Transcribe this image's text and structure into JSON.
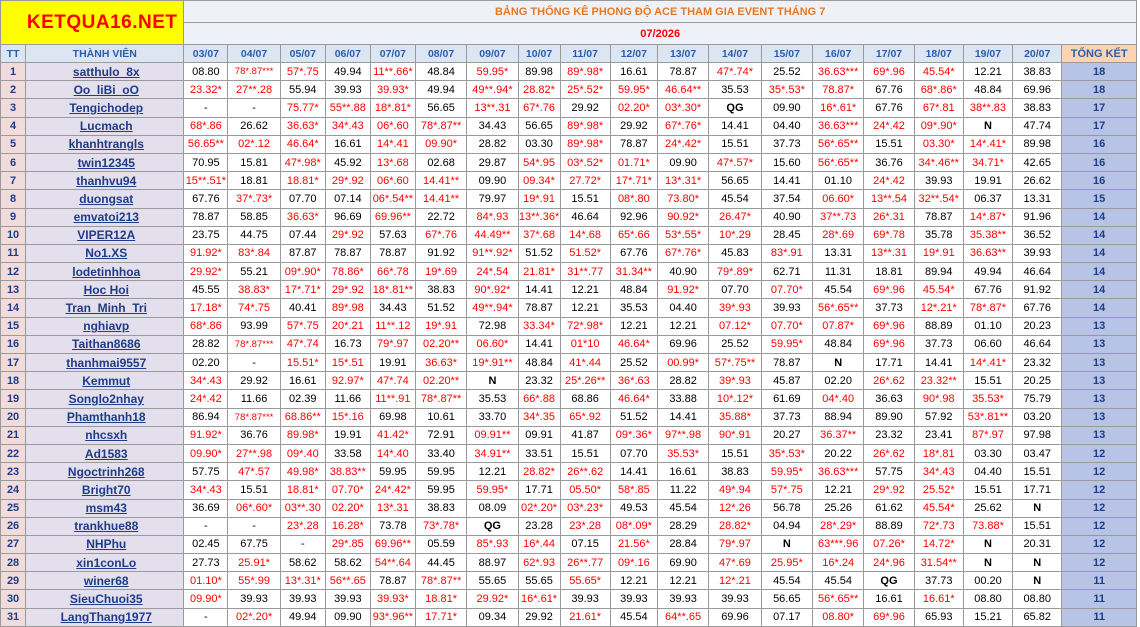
{
  "logo": "KETQUA16.NET",
  "title": "BẢNG THỐNG KÊ PHONG ĐỘ ACE THAM GIA EVENT THÁNG 7",
  "month": "07/2026",
  "columns": {
    "tt": "TT",
    "member": "THÀNH VIÊN",
    "dates": [
      "03/07",
      "04/07",
      "05/07",
      "06/07",
      "07/07",
      "08/07",
      "09/07",
      "10/07",
      "11/07",
      "12/07",
      "13/07",
      "14/07",
      "15/07",
      "16/07",
      "17/07",
      "18/07",
      "19/07",
      "20/07"
    ],
    "total": "TỔNG KẾT"
  },
  "colors": {
    "red_value": "#ff0000",
    "black_value": "#000000",
    "logo_bg": "#ffff00",
    "header_bg": "#dce6f2",
    "total_bg": "#b8c4e6",
    "name_bg": "#e4dfec"
  },
  "rows": [
    {
      "tt": "1",
      "name": "satthulo_8x",
      "total": "18",
      "values": [
        "08.80",
        "78*.87***",
        "57*.75",
        "49.94",
        "11**.66*",
        "48.84",
        "59.95*",
        "89.98",
        "89*.98*",
        "16.61",
        "78.87",
        "47*.74*",
        "25.52",
        "36.63***",
        "69*.96",
        "45.54*",
        "12.21",
        "38.83"
      ]
    },
    {
      "tt": "2",
      "name": "Oo_liBi_oO",
      "total": "18",
      "values": [
        "23.32*",
        "27**.28",
        "55.94",
        "39.93",
        "39.93*",
        "49.94",
        "49**.94*",
        "28.82*",
        "25*.52*",
        "59.95*",
        "46.64**",
        "35.53",
        "35*.53*",
        "78.87*",
        "67.76",
        "68*.86*",
        "48.84",
        "69.96"
      ]
    },
    {
      "tt": "3",
      "name": "Tengichodep",
      "total": "17",
      "values": [
        "-",
        "-",
        "75.77*",
        "55**.88",
        "18*.81*",
        "56.65",
        "13**.31",
        "67*.76",
        "29.92",
        "02.20*",
        "03*.30*",
        "QG",
        "09.90",
        "16*.61*",
        "67.76",
        "67*.81",
        "38**.83",
        "38.83"
      ]
    },
    {
      "tt": "4",
      "name": "Lucmach",
      "total": "17",
      "values": [
        "68*.86",
        "26.62",
        "36.63*",
        "34*.43",
        "06*.60",
        "78*.87**",
        "34.43",
        "56.65",
        "89*.98*",
        "29.92",
        "67*.76*",
        "14.41",
        "04.40",
        "36.63***",
        "24*.42",
        "09*.90*",
        "N",
        "47.74"
      ]
    },
    {
      "tt": "5",
      "name": "khanhtrangls",
      "total": "16",
      "values": [
        "56.65**",
        "02*.12",
        "46.64*",
        "16.61",
        "14*.41",
        "09.90*",
        "28.82",
        "03.30",
        "89*.98*",
        "78.87",
        "24*.42*",
        "15.51",
        "37.73",
        "56*.65**",
        "15.51",
        "03.30*",
        "14*.41*",
        "89.98"
      ]
    },
    {
      "tt": "6",
      "name": "twin12345",
      "total": "16",
      "values": [
        "70.95",
        "15.81",
        "47*.98*",
        "45.92",
        "13*.68",
        "02.68",
        "29.87",
        "54*.95",
        "03*.52*",
        "01.71*",
        "09.90",
        "47*.57*",
        "15.60",
        "56*.65**",
        "36.76",
        "34*.46**",
        "34.71*",
        "42.65"
      ]
    },
    {
      "tt": "7",
      "name": "thanhvu94",
      "total": "16",
      "values": [
        "15**.51*",
        "18.81",
        "18.81*",
        "29*.92",
        "06*.60",
        "14.41**",
        "09.90",
        "09.34*",
        "27.72*",
        "17*.71*",
        "13*.31*",
        "56.65",
        "14.41",
        "01.10",
        "24*.42",
        "39.93",
        "19.91",
        "26.62"
      ]
    },
    {
      "tt": "8",
      "name": "duongsat",
      "total": "15",
      "values": [
        "67.76",
        "37*.73*",
        "07.70",
        "07.14",
        "06*.54**",
        "14.41**",
        "79.97",
        "19*.91",
        "15.51",
        "08*.80",
        "73.80*",
        "45.54",
        "37.54",
        "06.60*",
        "13**.54",
        "32**.54*",
        "06.37",
        "13.31"
      ]
    },
    {
      "tt": "9",
      "name": "emvatoi213",
      "total": "14",
      "values": [
        "78.87",
        "58.85",
        "36.63*",
        "96.69",
        "69.96**",
        "22.72",
        "84*.93",
        "13**.36*",
        "46.64",
        "92.96",
        "90.92*",
        "26.47*",
        "40.90",
        "37**.73",
        "26*.31",
        "78.87",
        "14*.87*",
        "91.96"
      ]
    },
    {
      "tt": "10",
      "name": "VIPER12A",
      "total": "14",
      "values": [
        "23.75",
        "44.75",
        "07.44",
        "29*.92",
        "57.63",
        "67*.76",
        "44.49**",
        "37*.68",
        "14*.68",
        "65*.66",
        "53*.55*",
        "10*.29",
        "28.45",
        "28*.69",
        "69*.78",
        "35.78",
        "35.38**",
        "36.52"
      ]
    },
    {
      "tt": "11",
      "name": "No1.XS",
      "total": "14",
      "values": [
        "91.92*",
        "83*.84",
        "87.87",
        "78.87",
        "78.87",
        "91.92",
        "91**.92*",
        "51.52",
        "51.52*",
        "67.76",
        "67*.76*",
        "45.83",
        "83*.91",
        "13.31",
        "13**.31",
        "19*.91",
        "36.63**",
        "39.93"
      ]
    },
    {
      "tt": "12",
      "name": "lodetinhhoa",
      "total": "14",
      "values": [
        "29.92*",
        "55.21",
        "09*.90*",
        "78.86*",
        "66*.78",
        "19*.69",
        "24*.54",
        "21.81*",
        "31**.77",
        "31.34**",
        "40.90",
        "79*.89*",
        "62.71",
        "11.31",
        "18.81",
        "89.94",
        "49.94",
        "46.64"
      ]
    },
    {
      "tt": "13",
      "name": "Hoc Hoi",
      "total": "14",
      "values": [
        "45.55",
        "38.83*",
        "17*.71*",
        "29*.92",
        "18*.81**",
        "38.83",
        "90*.92*",
        "14.41",
        "12.21",
        "48.84",
        "91.92*",
        "07.70",
        "07.70*",
        "45.54",
        "69*.96",
        "45.54*",
        "67.76",
        "91.92"
      ]
    },
    {
      "tt": "14",
      "name": "Tran_Minh_Tri",
      "total": "14",
      "values": [
        "17.18*",
        "74*.75",
        "40.41",
        "89*.98",
        "34.43",
        "51.52",
        "49**.94*",
        "78.87",
        "12.21",
        "35.53",
        "04.40",
        "39*.93",
        "39.93",
        "56*.65**",
        "37.73",
        "12*.21*",
        "78*.87*",
        "67.76"
      ]
    },
    {
      "tt": "15",
      "name": "nghiavp",
      "total": "13",
      "values": [
        "68*.86",
        "93.99",
        "57*.75",
        "20*.21",
        "11**.12",
        "19*.91",
        "72.98",
        "33.34*",
        "72*.98*",
        "12.21",
        "12.21",
        "07.12*",
        "07.70*",
        "07.87*",
        "69*.96",
        "88.89",
        "01.10",
        "20.23"
      ]
    },
    {
      "tt": "16",
      "name": "Taithan8686",
      "total": "13",
      "values": [
        "28.82",
        "78*.87***",
        "47*.74",
        "16.73",
        "79*.97",
        "02.20**",
        "06.60*",
        "14.41",
        "01*10",
        "46.64*",
        "69.96",
        "25.52",
        "59.95*",
        "48.84",
        "69*.96",
        "37.73",
        "06.60",
        "46.64"
      ]
    },
    {
      "tt": "17",
      "name": "thanhmai9557",
      "total": "13",
      "values": [
        "02.20",
        "-",
        "15.51*",
        "15*.51",
        "19.91",
        "36.63*",
        "19*.91**",
        "48.84",
        "41*.44",
        "25.52",
        "00.99*",
        "57*.75**",
        "78.87",
        "N",
        "17.71",
        "14.41",
        "14*.41*",
        "23.32"
      ]
    },
    {
      "tt": "18",
      "name": "Kemmut",
      "total": "13",
      "values": [
        "34*.43",
        "29.92",
        "16.61",
        "92.97*",
        "47*.74",
        "02.20**",
        "N",
        "23.32",
        "25*.26**",
        "36*.63",
        "28.82",
        "39*.93",
        "45.87",
        "02.20",
        "26*.62",
        "23.32**",
        "15.51",
        "20.25"
      ]
    },
    {
      "tt": "19",
      "name": "Songlo2nhay",
      "total": "13",
      "values": [
        "24*.42",
        "11.66",
        "02.39",
        "11.66",
        "11**.91",
        "78*.87**",
        "35.53",
        "66*.88",
        "68.86",
        "46.64*",
        "33.88",
        "10*.12*",
        "61.69",
        "04*.40",
        "36.63",
        "90*.98",
        "35.53*",
        "75.79"
      ]
    },
    {
      "tt": "20",
      "name": "Phamthanh18",
      "total": "13",
      "values": [
        "86.94",
        "78*.87***",
        "68.86**",
        "15*.16",
        "69.98",
        "10.61",
        "33.70",
        "34*.35",
        "65*.92",
        "51.52",
        "14.41",
        "35.88*",
        "37.73",
        "88.94",
        "89.90",
        "57.92",
        "53*.81**",
        "03.20"
      ]
    },
    {
      "tt": "21",
      "name": "nhcsxh",
      "total": "13",
      "values": [
        "91.92*",
        "36.76",
        "89.98*",
        "19.91",
        "41.42*",
        "72.91",
        "09.91**",
        "09.91",
        "41.87",
        "09*.36*",
        "97**.98",
        "90*.91",
        "20.27",
        "36.37**",
        "23.32",
        "23.41",
        "87*.97",
        "97.98"
      ]
    },
    {
      "tt": "22",
      "name": "Ad1583",
      "total": "12",
      "values": [
        "09.90*",
        "27**.98",
        "09*.40",
        "33.58",
        "14*.40",
        "33.40",
        "34.91**",
        "33.51",
        "15.51",
        "07.70",
        "35.53*",
        "15.51",
        "35*.53*",
        "20.22",
        "26*.62",
        "18*.81",
        "03.30",
        "03.47"
      ]
    },
    {
      "tt": "23",
      "name": "Ngoctrinh268",
      "total": "12",
      "values": [
        "57.75",
        "47*.57",
        "49.98*",
        "38.83**",
        "59.95",
        "59.95",
        "12.21",
        "28.82*",
        "26**.62",
        "14.41",
        "16.61",
        "38.83",
        "59.95*",
        "36.63***",
        "57.75",
        "34*.43",
        "04.40",
        "15.51"
      ]
    },
    {
      "tt": "24",
      "name": "Bright70",
      "total": "12",
      "values": [
        "34*.43",
        "15.51",
        "18.81*",
        "07.70*",
        "24*.42*",
        "59.95",
        "59.95*",
        "17.71",
        "05.50*",
        "58*.85",
        "11.22",
        "49*.94",
        "57*.75",
        "12.21",
        "29*.92",
        "25.52*",
        "15.51",
        "17.71"
      ]
    },
    {
      "tt": "25",
      "name": "msm43",
      "total": "12",
      "values": [
        "36.69",
        "06*.60*",
        "03**.30",
        "02.20*",
        "13*.31",
        "38.83",
        "08.09",
        "02*.20*",
        "03*.23*",
        "49.53",
        "45.54",
        "12*.26",
        "56.78",
        "25.26",
        "61.62",
        "45.54*",
        "25.62",
        "N"
      ]
    },
    {
      "tt": "26",
      "name": "trankhue88",
      "total": "12",
      "values": [
        "-",
        "-",
        "23*.28",
        "16.28*",
        "73.78",
        "73*.78*",
        "QG",
        "23.28",
        "23*.28",
        "08*.09*",
        "28.29",
        "28.82*",
        "04.94",
        "28*.29*",
        "88.89",
        "72*.73",
        "73.88*",
        "15.51"
      ]
    },
    {
      "tt": "27",
      "name": "NHPhu",
      "total": "12",
      "values": [
        "02.45",
        "67.75",
        "-",
        "29*.85",
        "69.96**",
        "05.59",
        "85*.93",
        "16*.44",
        "07.15",
        "21.56*",
        "28.84",
        "79*.97",
        "N",
        "63***.96",
        "07.26*",
        "14.72*",
        "N",
        "20.31"
      ]
    },
    {
      "tt": "28",
      "name": "xin1conLo",
      "total": "12",
      "values": [
        "27.73",
        "25.91*",
        "58.62",
        "58.62",
        "54**.64",
        "44.45",
        "88.97",
        "62*.93",
        "26**.77",
        "09*.16",
        "69.90",
        "47*.69",
        "25.95*",
        "16*.24",
        "24*.96",
        "31.54**",
        "N",
        "N"
      ]
    },
    {
      "tt": "29",
      "name": "winer68",
      "total": "11",
      "values": [
        "01.10*",
        "55*.99",
        "13*.31*",
        "56**.65",
        "78.87",
        "78*.87**",
        "55.65",
        "55.65",
        "55.65*",
        "12.21",
        "12.21",
        "12*.21",
        "45.54",
        "45.54",
        "QG",
        "37.73",
        "00.20",
        "N"
      ]
    },
    {
      "tt": "30",
      "name": "SieuChuoi35",
      "total": "11",
      "values": [
        "09.90*",
        "39.93",
        "39.93",
        "39.93",
        "39.93*",
        "18.81*",
        "29.92*",
        "16*.61*",
        "39.93",
        "39.93",
        "39.93",
        "39.93",
        "56.65",
        "56*.65**",
        "16.61",
        "16.61*",
        "08.80",
        "08.80"
      ]
    },
    {
      "tt": "31",
      "name": "LangThang1977",
      "total": "11",
      "values": [
        "-",
        "02*.20*",
        "49.94",
        "09.90",
        "93*.96**",
        "17.71*",
        "09.34",
        "29.92",
        "21.61*",
        "45.54",
        "64**.65",
        "69.96",
        "07.17",
        "08.80*",
        "69*.96",
        "65.93",
        "15.21",
        "65.82"
      ]
    }
  ]
}
